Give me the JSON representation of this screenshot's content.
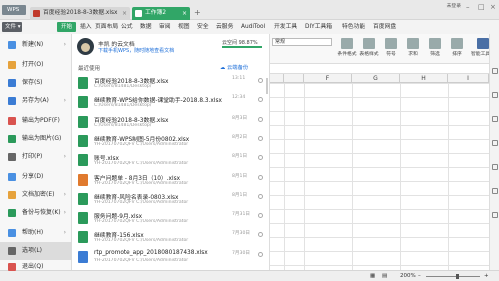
{
  "titlebar": {
    "wps_label": "WPS",
    "tabs": [
      {
        "label": "百度经验2018-8-3数据.xlsx"
      },
      {
        "label": "工作簿2"
      }
    ],
    "user_label": "未登录",
    "plus_icon": "plus-icon"
  },
  "menubar": {
    "file_label": "文件",
    "start_label": "开始",
    "items": [
      "插入",
      "页面布局",
      "公式",
      "数据",
      "审阅",
      "视图",
      "安全",
      "云服务",
      "AudiTool",
      "开发工具",
      "DIY工具箱",
      "特色功能",
      "百度网盘"
    ]
  },
  "toolbar": {
    "font_value": "常规",
    "tools": [
      "条件格式",
      "表格样式",
      "符号",
      "求和",
      "筛选",
      "排序",
      "智能工具箱"
    ]
  },
  "grid": {
    "columns": [
      "",
      "",
      "F",
      "G",
      "H",
      "I"
    ]
  },
  "left_menu": [
    {
      "label": "新建(N)",
      "icon": "new-file-icon",
      "arrow": true,
      "color": "#4a90e2"
    },
    {
      "label": "打开(O)",
      "icon": "open-folder-icon",
      "arrow": false,
      "color": "#e6a23c"
    },
    {
      "label": "保存(S)",
      "icon": "save-icon",
      "arrow": false,
      "color": "#3b7cd4"
    },
    {
      "label": "另存为(A)",
      "icon": "save-as-icon",
      "arrow": true,
      "color": "#3b7cd4"
    },
    {
      "label": "输出为PDF(F)",
      "icon": "pdf-icon",
      "arrow": false,
      "color": "#d9534f"
    },
    {
      "label": "输出为图片(G)",
      "icon": "image-icon",
      "arrow": false,
      "color": "#2b9a5b"
    },
    {
      "label": "打印(P)",
      "icon": "printer-icon",
      "arrow": true,
      "color": "#666666"
    },
    {
      "label": "分享(D)",
      "icon": "share-icon",
      "arrow": false,
      "color": "#4a90e2"
    },
    {
      "label": "文档加密(E)",
      "icon": "lock-icon",
      "arrow": true,
      "color": "#e6a23c"
    },
    {
      "label": "备份与恢复(K)",
      "icon": "backup-icon",
      "arrow": true,
      "color": "#2b9a5b"
    },
    {
      "label": "帮助(H)",
      "icon": "help-icon",
      "arrow": true,
      "color": "#4a90e2"
    },
    {
      "label": "选项(L)",
      "icon": "gear-icon",
      "arrow": false,
      "color": "#666666"
    },
    {
      "label": "退出(Q)",
      "icon": "exit-icon",
      "arrow": false,
      "color": "#d9534f"
    }
  ],
  "profile": {
    "name": "丰凯 的云文档",
    "hint": "下载手机WPS，随时随地查看文档",
    "cloud_label": "云空间 98.87%",
    "cloud_usage": 0.9887
  },
  "recent": {
    "header": "最近使用",
    "cloud_sync": "云端备份",
    "files": [
      {
        "name": "百度经验2018-8-3数据.xlsx",
        "path": "C:/Users/81481/Desktop/",
        "time": "13:11",
        "kind": "green"
      },
      {
        "name": "继续教育-WPS给你数据-课堂助手-2018.8.3.xlsx",
        "path": "C:/Users/81481/Desktop/",
        "time": "12:34",
        "kind": "green"
      },
      {
        "name": "百度经验2018-8-3数据.xlsx",
        "path": "C:/Users/81481/Desktop/",
        "time": "8月3日",
        "kind": "green"
      },
      {
        "name": "继续教育-WPS制图-5月份0802.xlsx",
        "path": "YH-20170702QFV C:/Users/Administrator",
        "time": "8月2日",
        "kind": "green"
      },
      {
        "name": "账号.xlsx",
        "path": "YH-20170702QFV C:/Users/Administrator",
        "time": "8月1日",
        "kind": "green"
      },
      {
        "name": "客户问题单 - 8月3日（10）.xlsx",
        "path": "YH-20170702QFV C:/Users/Administrator",
        "time": "8月1日",
        "kind": "orange"
      },
      {
        "name": "继续教育-风险名表录-0803.xlsx",
        "path": "YH-20170702QFV C:/Users/Administrator",
        "time": "8月1日",
        "kind": "green"
      },
      {
        "name": "服务问题-9月.xlsx",
        "path": "YH-20170702QFV C:/Users/Administrator",
        "time": "7月31日",
        "kind": "green"
      },
      {
        "name": "继续教育-156.xlsx",
        "path": "YH-20170702QFV C:/Users/Administrator",
        "time": "7月30日",
        "kind": "green"
      },
      {
        "name": "rtp_promote_app_2018080187438.xlsx",
        "path": "YH-20170702QFV C:/Users/Administrator",
        "time": "7月30日",
        "kind": "blue"
      }
    ]
  },
  "status": {
    "zoom": "200%",
    "minus_icon": "zoom-out-icon",
    "plus_icon": "zoom-in-icon"
  }
}
